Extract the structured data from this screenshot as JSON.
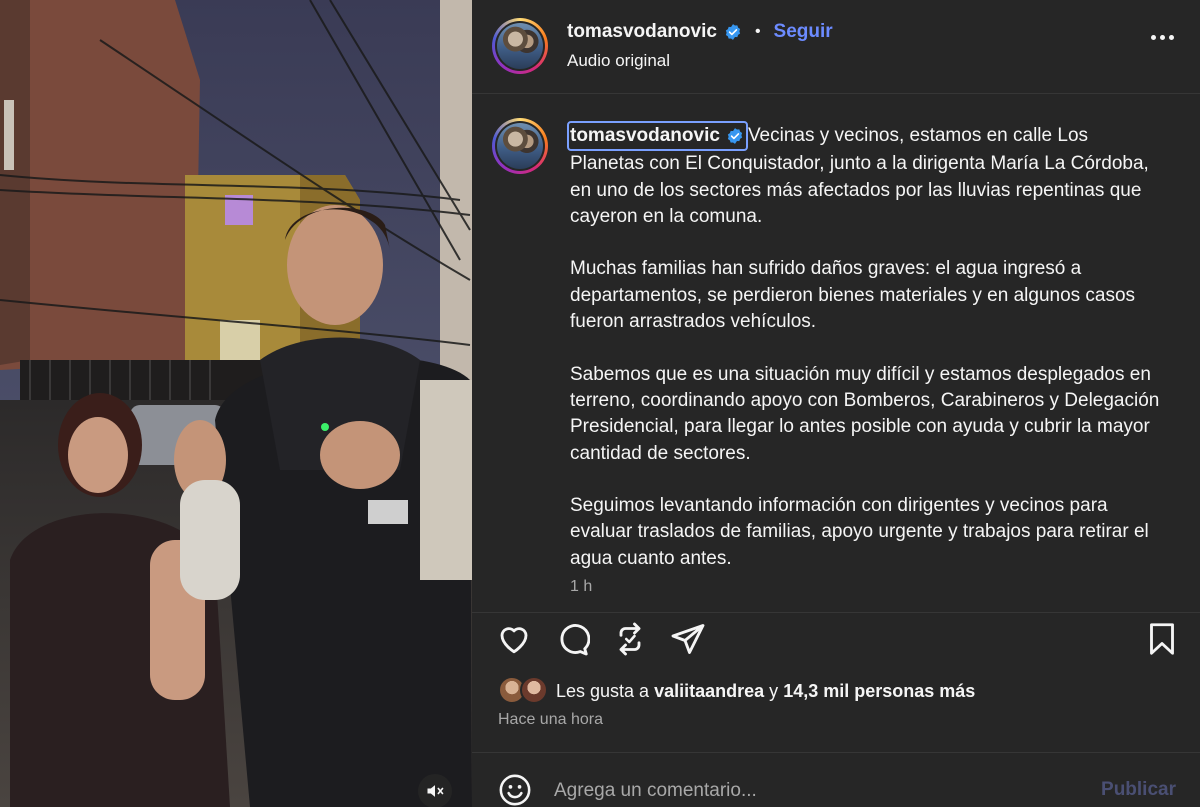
{
  "post": {
    "username": "tomasvodanovic",
    "follow_label": "Seguir",
    "audio_label": "Audio original",
    "separator": "•",
    "caption_paragraphs": [
      "Vecinas y vecinos, estamos en calle Los Planetas con El Conquistador, junto a la dirigenta María La Córdoba, en uno de los sectores más afectados por las lluvias repentinas que cayeron en la comuna.",
      "Muchas familias han sufrido daños graves: el agua ingresó a departamentos, se perdieron bienes materiales y en algunos casos fueron arrastrados vehículos.",
      "Sabemos que es una situación muy difícil y estamos desplegados en terreno, coordinando apoyo con Bomberos, Carabineros y Delegación Presidencial, para llegar lo antes posible con ayuda y cubrir la mayor cantidad de sectores.",
      "Seguimos levantando información con dirigentes y vecinos para evaluar traslados de familias, apoyo urgente y trabajos para retirar el agua cuanto antes."
    ],
    "caption_time": "1 h",
    "likes": {
      "prefix": "Les gusta a",
      "user": "valiitaandrea",
      "connector": "y",
      "count_text": "14,3 mil personas más"
    },
    "posted_when": "Hace una hora"
  },
  "comment": {
    "placeholder": "Agrega un comentario...",
    "publish_label": "Publicar"
  },
  "icons": {
    "more": "more-options-icon",
    "like": "heart-icon",
    "comment": "comment-bubble-icon",
    "repost": "repost-icon",
    "share": "send-icon",
    "save": "bookmark-icon",
    "emoji": "emoji-icon",
    "mute": "muted-speaker-icon",
    "verified": "verified-badge-icon"
  },
  "colors": {
    "panel_bg": "#262626",
    "accent_link": "#6c8bff",
    "verified": "#3797f0",
    "muted_text": "#a8a8a8",
    "publish_disabled": "#4a4f73"
  }
}
